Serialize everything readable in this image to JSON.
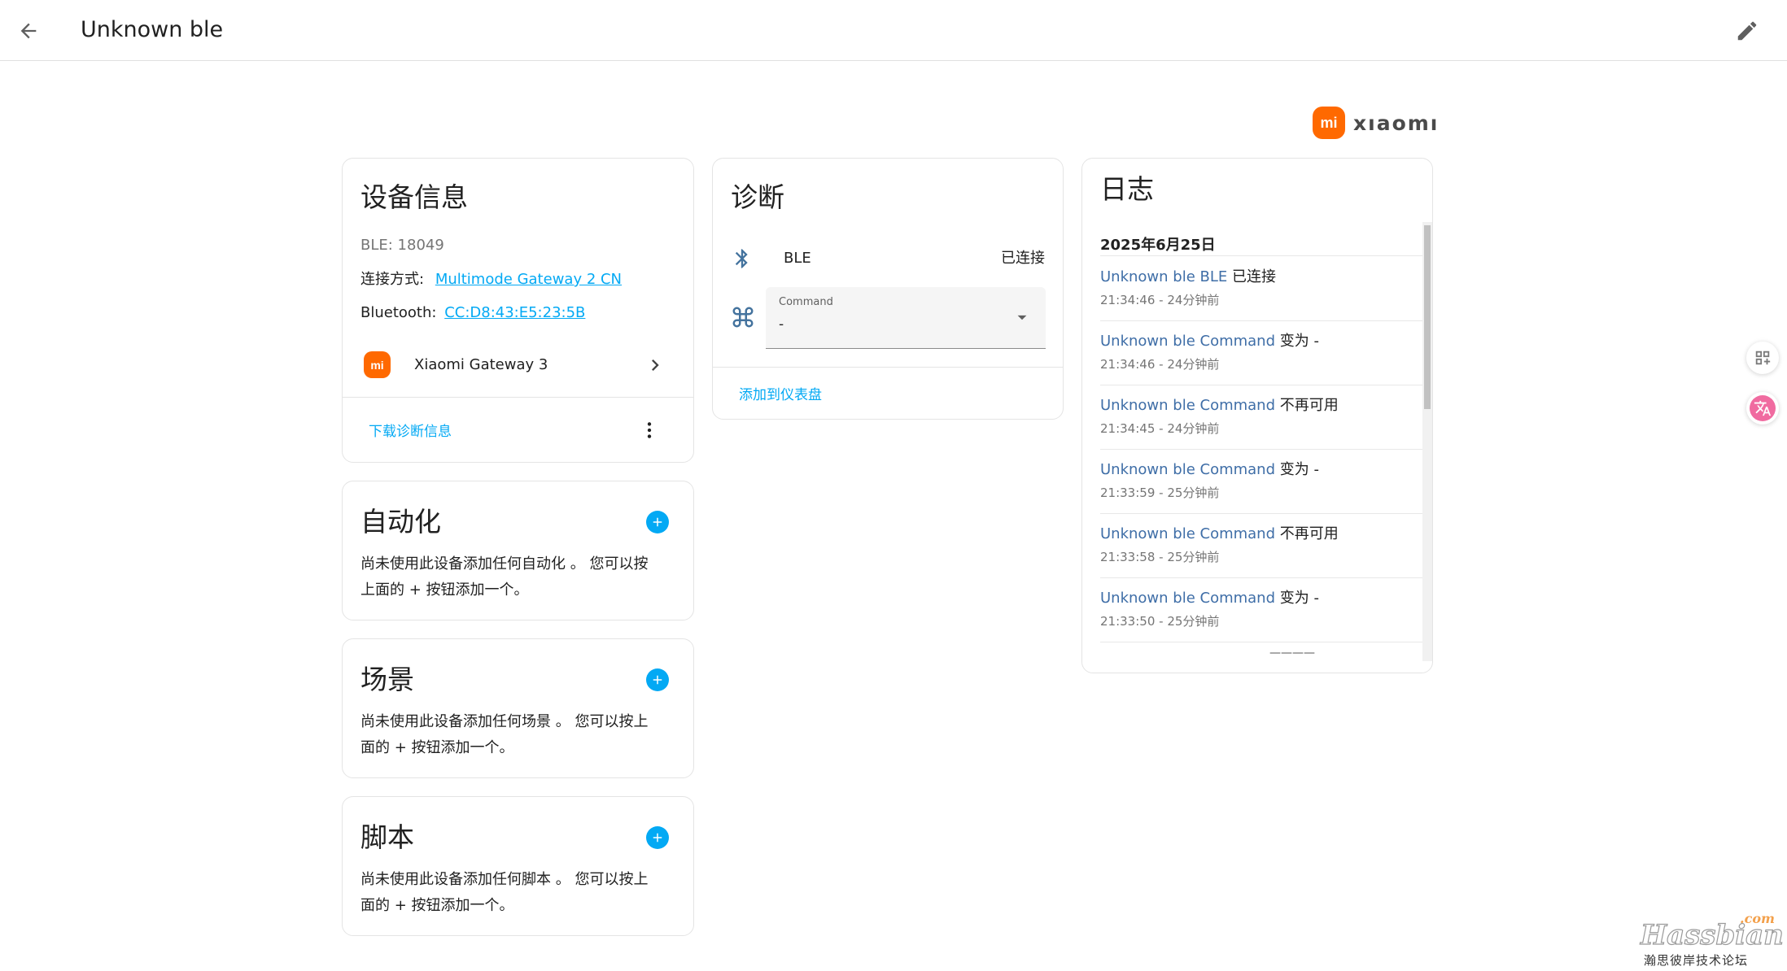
{
  "topbar": {
    "title": "Unknown ble"
  },
  "brand": {
    "logo_text": "mi",
    "name": "xıaomı",
    "color": "#ff6900"
  },
  "device_info": {
    "title": "设备信息",
    "ble_id": "BLE: 18049",
    "connection_label": "连接方式:",
    "connection_value": "Multimode Gateway 2 CN",
    "bluetooth_label": "Bluetooth:",
    "bluetooth_value": "CC:D8:43:E5:23:5B",
    "parent_device": "Xiaomi Gateway 3",
    "download_label": "下载诊断信息"
  },
  "automation": {
    "title": "自动化",
    "line1": "尚未使用此设备添加任何自动化 。 您可以按",
    "line2": "上面的 + 按钮添加一个。"
  },
  "scene": {
    "title": "场景",
    "line1": "尚未使用此设备添加任何场景 。 您可以按上",
    "line2": "面的 + 按钮添加一个。"
  },
  "script": {
    "title": "脚本",
    "line1": "尚未使用此设备添加任何脚本 。 您可以按上",
    "line2": "面的 + 按钮添加一个。"
  },
  "diagnostics": {
    "title": "诊断",
    "ble_label": "BLE",
    "ble_status": "已连接",
    "command_label": "Command",
    "command_value": "-",
    "add_to_dashboard": "添加到仪表盘"
  },
  "log": {
    "title": "日志",
    "date": "2025年6月25日",
    "entries": [
      {
        "name": "Unknown ble BLE",
        "action": "已连接",
        "time": "21:34:46 - 24分钟前"
      },
      {
        "name": "Unknown ble Command",
        "action": "变为 -",
        "time": "21:34:46 - 24分钟前"
      },
      {
        "name": "Unknown ble Command",
        "action": "不再可用",
        "time": "21:34:45 - 24分钟前"
      },
      {
        "name": "Unknown ble Command",
        "action": "变为 -",
        "time": "21:33:59 - 25分钟前"
      },
      {
        "name": "Unknown ble Command",
        "action": "不再可用",
        "time": "21:33:58 - 25分钟前"
      },
      {
        "name": "Unknown ble Command",
        "action": "变为 -",
        "time": "21:33:50 - 25分钟前"
      }
    ],
    "more": "————"
  },
  "watermark": {
    "brand": "Hassbian",
    "domain": ".com",
    "caption": "瀚思彼岸技术论坛"
  },
  "colors": {
    "accent": "#03a9f4",
    "log_link": "#3f6ea7",
    "xiaomi_orange": "#ff6900"
  }
}
